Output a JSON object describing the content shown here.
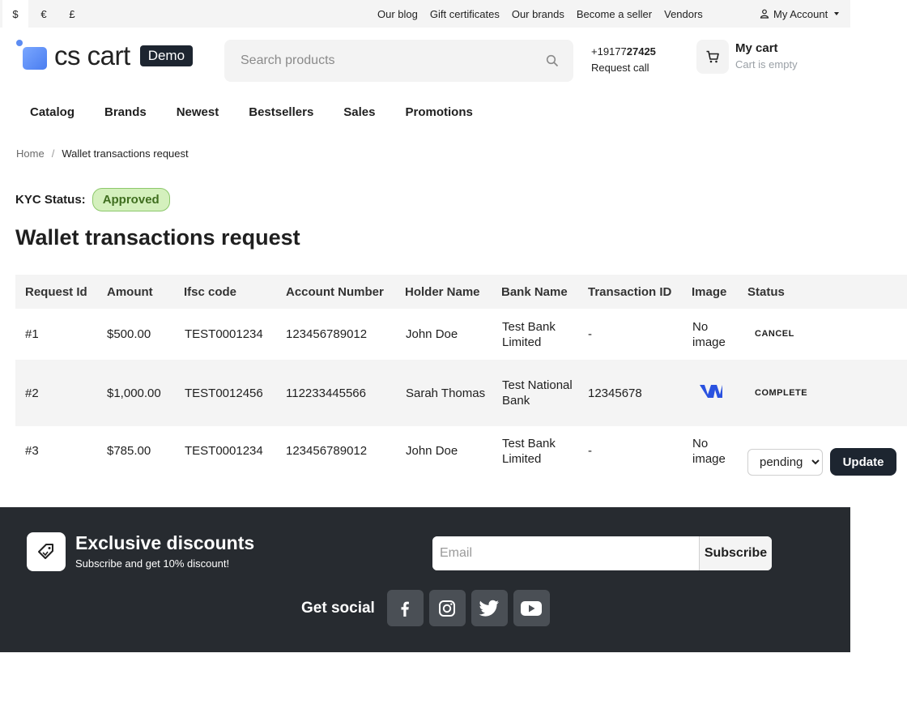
{
  "topbar": {
    "currencies": [
      "$",
      "€",
      "£"
    ],
    "links": [
      "Our blog",
      "Gift certificates",
      "Our brands",
      "Become a seller",
      "Vendors"
    ],
    "account_label": "My Account"
  },
  "header": {
    "logo_text": "cs cart",
    "demo_label": "Demo",
    "search_placeholder": "Search products",
    "phone_prefix": "+19177",
    "phone_bold": "27425",
    "request_call": "Request call",
    "cart_title": "My cart",
    "cart_status": "Cart is empty"
  },
  "nav": [
    "Catalog",
    "Brands",
    "Newest",
    "Bestsellers",
    "Sales",
    "Promotions"
  ],
  "breadcrumb": {
    "home": "Home",
    "separator": "/",
    "current": "Wallet transactions request"
  },
  "kyc": {
    "label": "KYC Status:",
    "status": "Approved"
  },
  "page_title": "Wallet transactions request",
  "table": {
    "headers": [
      "Request Id",
      "Amount",
      "Ifsc code",
      "Account Number",
      "Holder Name",
      "Bank Name",
      "Transaction ID",
      "Image",
      "Status"
    ],
    "rows": [
      {
        "id": "#1",
        "amount": "$500.00",
        "ifsc": "TEST0001234",
        "account": "123456789012",
        "holder": "John Doe",
        "bank": "Test Bank Limited",
        "txn": "-",
        "image": "No image",
        "status": "CANCEL"
      },
      {
        "id": "#2",
        "amount": "$1,000.00",
        "ifsc": "TEST0012456",
        "account": "112233445566",
        "holder": "Sarah Thomas",
        "bank": "Test National Bank",
        "txn": "12345678",
        "image": "",
        "status": "COMPLETE"
      },
      {
        "id": "#3",
        "amount": "$785.00",
        "ifsc": "TEST0001234",
        "account": "123456789012",
        "holder": "John Doe",
        "bank": "Test Bank Limited",
        "txn": "-",
        "image": "No image",
        "status_select": "pending",
        "update_label": "Update"
      }
    ]
  },
  "footer": {
    "promo_title": "Exclusive discounts",
    "promo_subtitle": "Subscribe and get 10% discount!",
    "email_placeholder": "Email",
    "subscribe_label": "Subscribe",
    "social_label": "Get social",
    "social_icons": [
      "facebook-icon",
      "instagram-icon",
      "twitter-icon",
      "youtube-icon"
    ]
  },
  "colors": {
    "accent_dark": "#1d2530",
    "footer_bg": "#272b30",
    "kyc_bg": "#d4f0bd",
    "kyc_text": "#3f6e1f",
    "logo_blue": "#4a7df0"
  }
}
